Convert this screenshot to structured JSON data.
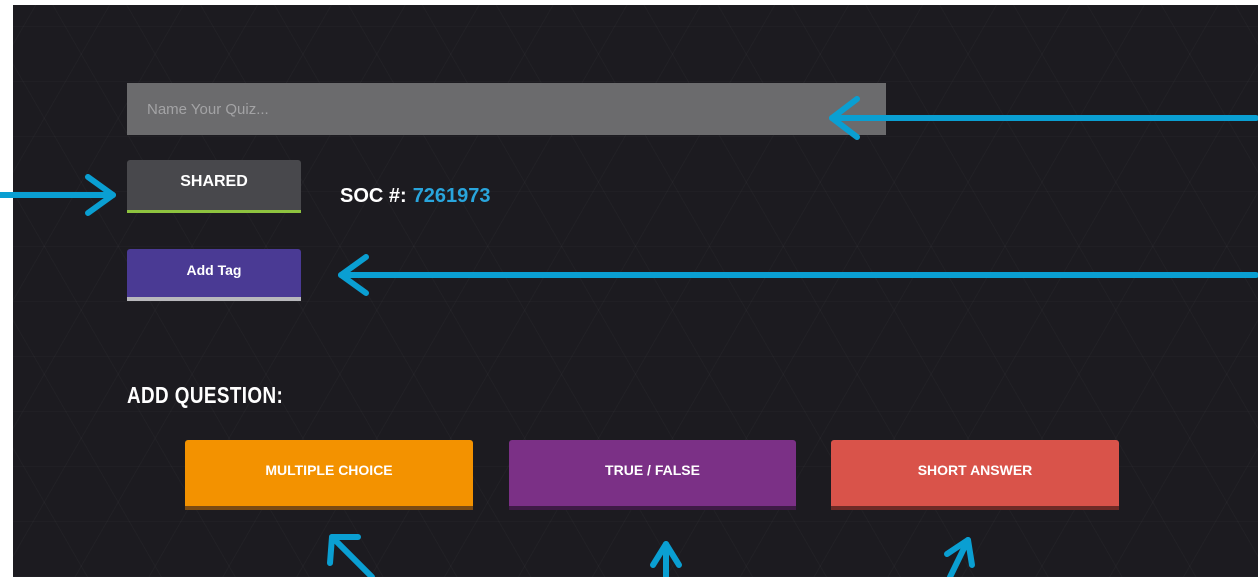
{
  "quiz": {
    "name_placeholder": "Name Your Quiz...",
    "name_value": ""
  },
  "sharing": {
    "shared_label": "SHARED",
    "soc_label": "SOC #:",
    "soc_number": "7261973"
  },
  "tags": {
    "add_tag_label": "Add Tag"
  },
  "questions": {
    "heading": "ADD QUESTION:",
    "multiple_choice_label": "MULTIPLE CHOICE",
    "true_false_label": "TRUE / FALSE",
    "short_answer_label": "SHORT ANSWER"
  },
  "colors": {
    "background": "#1c1b20",
    "input_bg": "#6b6b6d",
    "shared_underline": "#8ec33f",
    "soc_number": "#29a5dc",
    "add_tag_bg": "#4a3a94",
    "multiple_choice_bg": "#f39200",
    "true_false_bg": "#7b3086",
    "short_answer_bg": "#d9534a",
    "annotation_arrow": "#0a9fd2"
  }
}
